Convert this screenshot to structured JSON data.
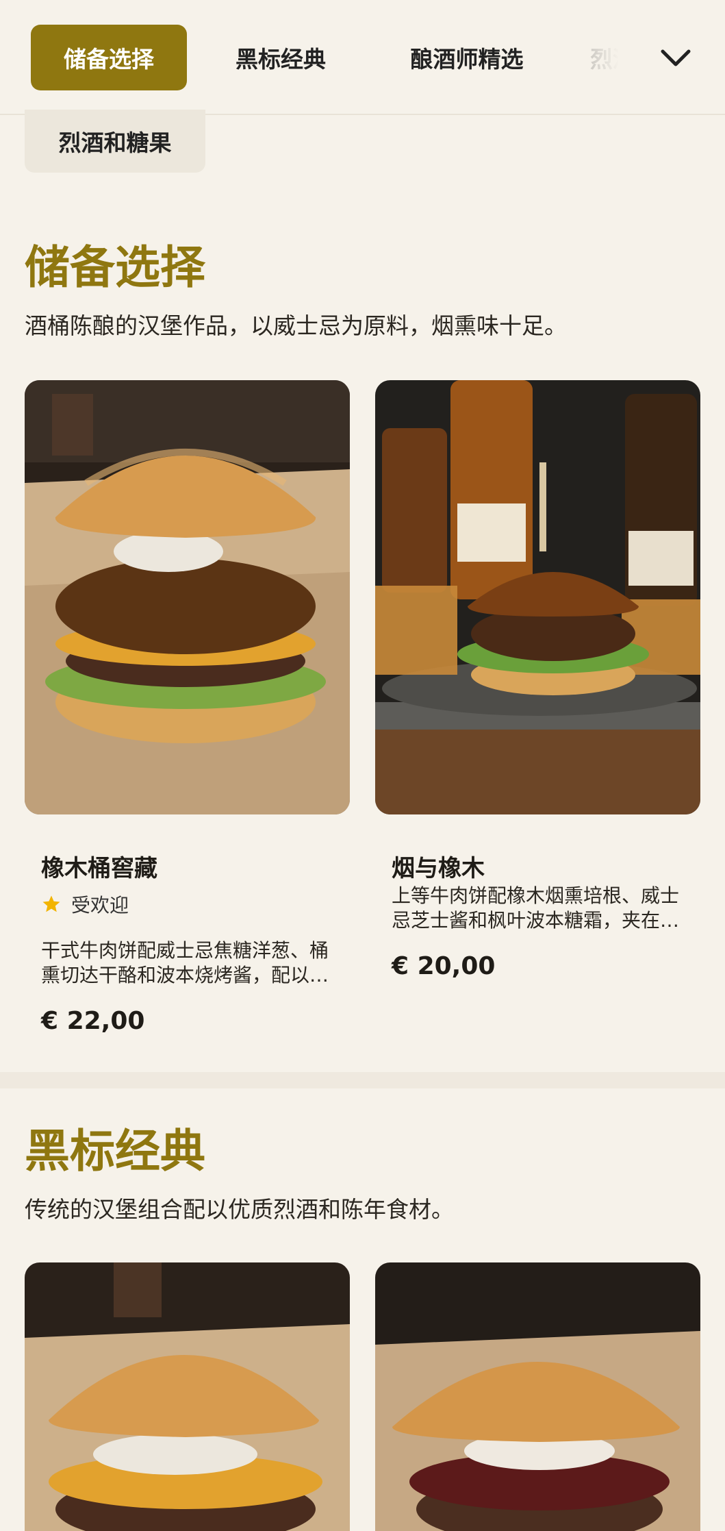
{
  "nav": {
    "tabs": [
      {
        "label": "储备选择",
        "active": true
      },
      {
        "label": "黑标经典",
        "active": false
      },
      {
        "label": "酿酒师精选",
        "active": false
      },
      {
        "label": "烈酒",
        "active": false
      }
    ],
    "overflow_chip": "烈酒和糖果",
    "expand_icon": "chevron-down-icon"
  },
  "colors": {
    "accent": "#8f7710",
    "background": "#f6f2ea"
  },
  "sections": [
    {
      "title": "储备选择",
      "description": "酒桶陈酿的汉堡作品，以威士忌为原料，烟熏味十足。",
      "items": [
        {
          "name": "橡木桶窖藏",
          "badge": "受欢迎",
          "badge_icon": "star-icon",
          "description": "干式牛肉饼配威士忌焦糖洋葱、桶熏切达干酪和波本烧烤酱，配以烤面包和生菜。",
          "price": "€ 22,00"
        },
        {
          "name": "烟与橡木",
          "description": "上等牛肉饼配橡木烟熏培根、威士忌芝士酱和枫叶波本糖霜，夹在布里欧修面包中。",
          "price": "€ 20,00"
        }
      ]
    },
    {
      "title": "黑标经典",
      "description": "传统的汉堡组合配以优质烈酒和陈年食材。"
    }
  ]
}
